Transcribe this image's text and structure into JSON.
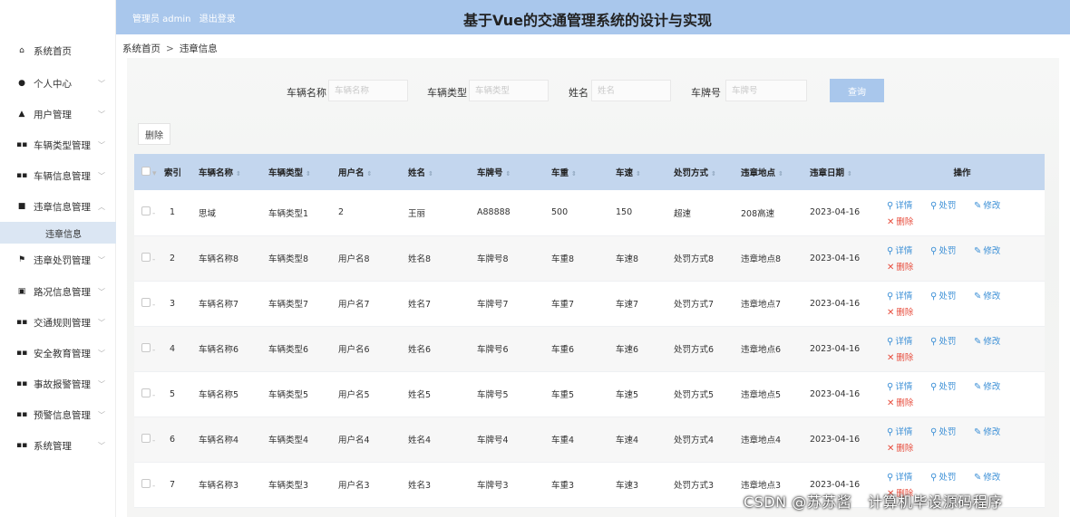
{
  "header": {
    "admin_label": "管理员 admin",
    "logout_label": "退出登录",
    "title": "基于Vue的交通管理系统的设计与实现"
  },
  "sidebar": {
    "items": [
      {
        "label": "系统首页",
        "icon": "home-icon",
        "glyph": "⌂",
        "has_chevron": false
      },
      {
        "label": "个人中心",
        "icon": "person-icon",
        "glyph": "●",
        "has_chevron": true
      },
      {
        "label": "用户管理",
        "icon": "user-icon",
        "glyph": "▲",
        "has_chevron": true
      },
      {
        "label": "车辆类型管理",
        "icon": "grid-icon",
        "glyph": "▪▪",
        "has_chevron": true
      },
      {
        "label": "车辆信息管理",
        "icon": "grid-icon",
        "glyph": "▪▪",
        "has_chevron": true
      },
      {
        "label": "违章信息管理",
        "icon": "chat-icon",
        "glyph": "■",
        "has_chevron": true,
        "expanded": true
      },
      {
        "label": "违章处罚管理",
        "icon": "flag-icon",
        "glyph": "⚑",
        "has_chevron": true
      },
      {
        "label": "路况信息管理",
        "icon": "doc-icon",
        "glyph": "▣",
        "has_chevron": true
      },
      {
        "label": "交通规则管理",
        "icon": "grid-icon",
        "glyph": "▪▪",
        "has_chevron": true
      },
      {
        "label": "安全教育管理",
        "icon": "grid-icon",
        "glyph": "▪▪",
        "has_chevron": true
      },
      {
        "label": "事故报警管理",
        "icon": "grid-icon",
        "glyph": "▪▪",
        "has_chevron": true
      },
      {
        "label": "预警信息管理",
        "icon": "grid-icon",
        "glyph": "▪▪",
        "has_chevron": true
      },
      {
        "label": "系统管理",
        "icon": "grid-icon",
        "glyph": "▪▪",
        "has_chevron": true
      }
    ],
    "sub_item": "违章信息"
  },
  "breadcrumb": {
    "home": "系统首页",
    "separator": ">",
    "current": "违章信息"
  },
  "search": {
    "fields": [
      {
        "label": "车辆名称",
        "placeholder": "车辆名称"
      },
      {
        "label": "车辆类型",
        "placeholder": "车辆类型"
      },
      {
        "label": "姓名",
        "placeholder": "姓名"
      },
      {
        "label": "车牌号",
        "placeholder": "车牌号"
      }
    ],
    "query_label": "查询"
  },
  "toolbar": {
    "delete_label": "删除"
  },
  "table": {
    "columns": [
      "索引",
      "车辆名称",
      "车辆类型",
      "用户名",
      "姓名",
      "车牌号",
      "车重",
      "车速",
      "处罚方式",
      "违章地点",
      "违章日期",
      "操作"
    ],
    "rows": [
      [
        "1",
        "思域",
        "车辆类型1",
        "2",
        "王丽",
        "A88888",
        "500",
        "150",
        "超速",
        "208高速",
        "2023-04-16"
      ],
      [
        "2",
        "车辆名称8",
        "车辆类型8",
        "用户名8",
        "姓名8",
        "车牌号8",
        "车重8",
        "车速8",
        "处罚方式8",
        "违章地点8",
        "2023-04-16"
      ],
      [
        "3",
        "车辆名称7",
        "车辆类型7",
        "用户名7",
        "姓名7",
        "车牌号7",
        "车重7",
        "车速7",
        "处罚方式7",
        "违章地点7",
        "2023-04-16"
      ],
      [
        "4",
        "车辆名称6",
        "车辆类型6",
        "用户名6",
        "姓名6",
        "车牌号6",
        "车重6",
        "车速6",
        "处罚方式6",
        "违章地点6",
        "2023-04-16"
      ],
      [
        "5",
        "车辆名称5",
        "车辆类型5",
        "用户名5",
        "姓名5",
        "车牌号5",
        "车重5",
        "车速5",
        "处罚方式5",
        "违章地点5",
        "2023-04-16"
      ],
      [
        "6",
        "车辆名称4",
        "车辆类型4",
        "用户名4",
        "姓名4",
        "车牌号4",
        "车重4",
        "车速4",
        "处罚方式4",
        "违章地点4",
        "2023-04-16"
      ],
      [
        "7",
        "车辆名称3",
        "车辆类型3",
        "用户名3",
        "姓名3",
        "车牌号3",
        "车重3",
        "车速3",
        "处罚方式3",
        "违章地点3",
        "2023-04-16"
      ]
    ],
    "actions": {
      "detail": "详情",
      "penalty": "处罚",
      "edit": "修改",
      "delete": "删除"
    }
  },
  "watermark": {
    "left": "CSDN @苏苏酱",
    "right": "计算机毕设源码程序"
  },
  "colors": {
    "header_bg": "#a9c7ec",
    "table_header_bg": "#c3d6ee",
    "link_blue": "#3b8fd6",
    "delete_red": "#e74c3c",
    "sidebar_active_bg": "#dbe6f3"
  }
}
